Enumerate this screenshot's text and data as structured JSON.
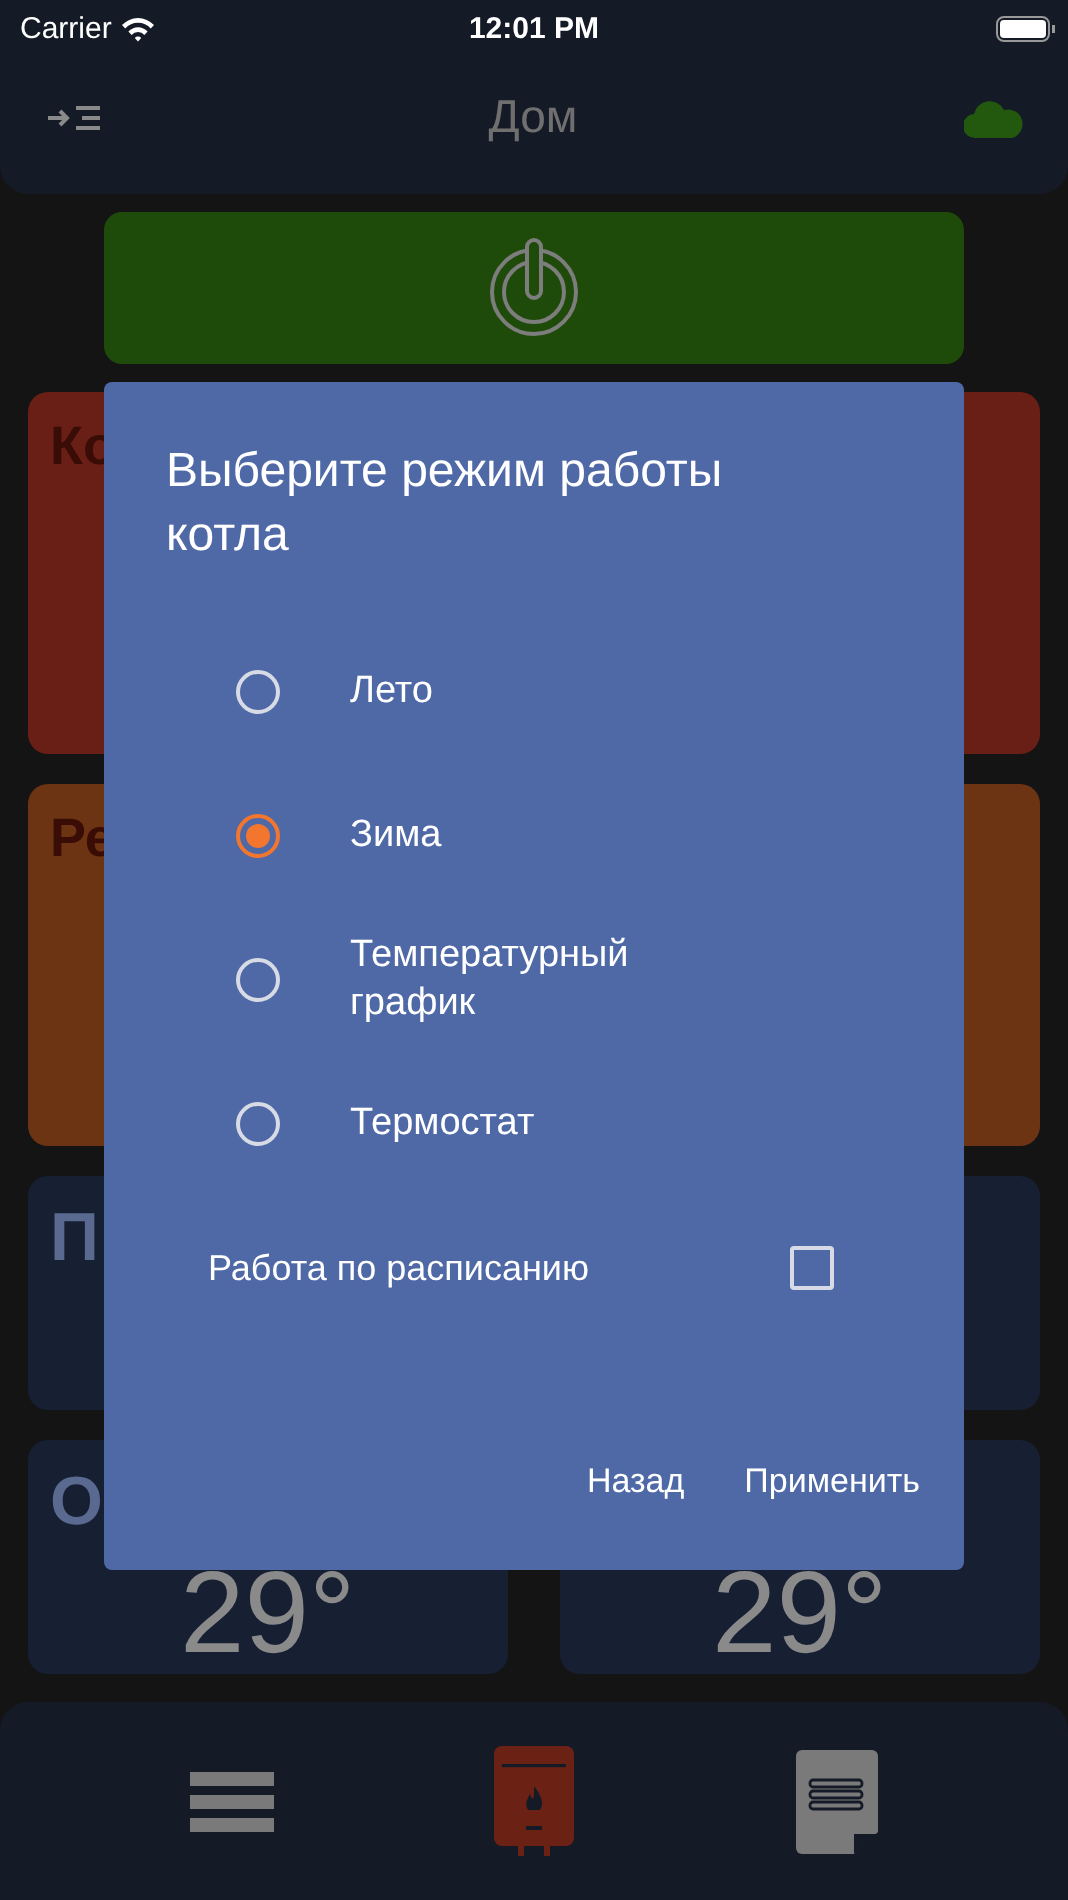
{
  "status_bar": {
    "carrier": "Carrier",
    "time": "12:01 PM"
  },
  "header": {
    "title": "Дом"
  },
  "cards": [
    {
      "kind": "wide",
      "color": "#6a1f16",
      "title": "Ко"
    },
    {
      "kind": "wide",
      "color": "#6c3413",
      "title": "Ре"
    },
    {
      "kind": "tile",
      "title": "П"
    },
    {
      "kind": "tile"
    },
    {
      "kind": "tile",
      "title": "О",
      "value": "29°"
    },
    {
      "kind": "tile",
      "value": "29°"
    }
  ],
  "dialog": {
    "title": "Выберите режим работы котла",
    "options": [
      {
        "label": "Лето",
        "selected": false
      },
      {
        "label": "Зима",
        "selected": true
      },
      {
        "label": "Температурный график",
        "selected": false
      },
      {
        "label": "Термостат",
        "selected": false
      }
    ],
    "schedule": {
      "label": "Работа по расписанию",
      "checked": false
    },
    "buttons": [
      "Назад",
      "Применить"
    ]
  },
  "bottom_nav": [
    {
      "kind": "menu",
      "selected": false
    },
    {
      "kind": "boiler",
      "selected": true
    },
    {
      "kind": "document",
      "selected": false
    }
  ]
}
